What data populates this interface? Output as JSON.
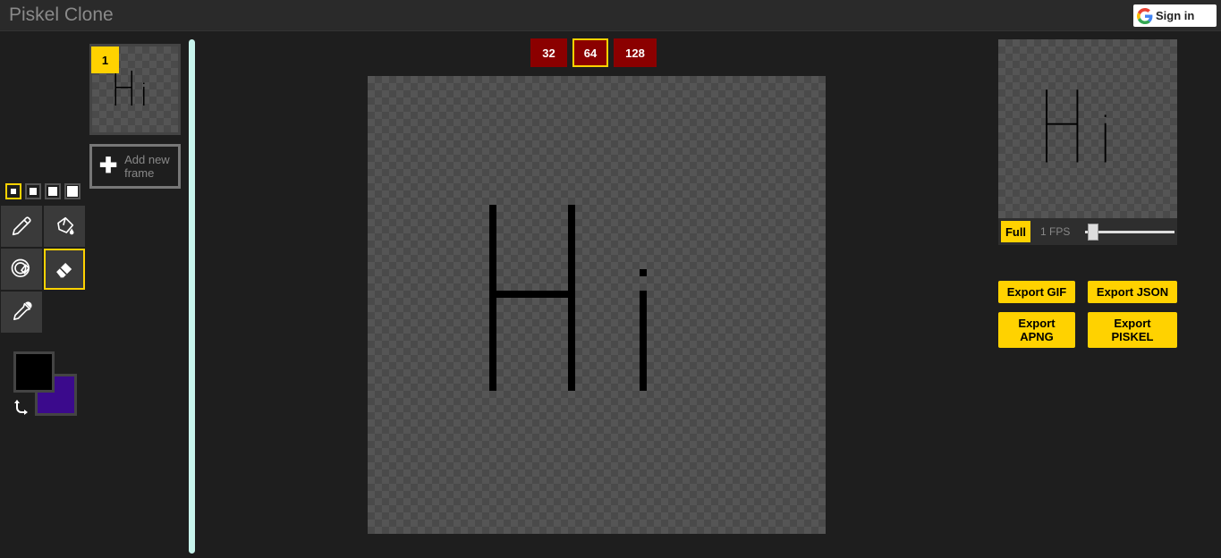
{
  "app": {
    "title": "Piskel Clone"
  },
  "auth": {
    "sign_in_label": "Sign in"
  },
  "frames": [
    {
      "number": "1"
    }
  ],
  "add_frame_label": "Add new frame",
  "resolutions": [
    {
      "label": "32",
      "active": false
    },
    {
      "label": "64",
      "active": true
    },
    {
      "label": "128",
      "active": false
    }
  ],
  "tools": [
    "pencil-icon",
    "paint-bucket-icon",
    "same-color-fill-icon",
    "eraser-icon",
    "eyedropper-icon"
  ],
  "active_tool": "eraser",
  "colors": {
    "primary": "#000000",
    "secondary": "#3b0a8c",
    "accent": "#ffd200",
    "resolution_button": "#8b0000"
  },
  "canvas": {
    "drawing_text": "Hi"
  },
  "preview": {
    "full_label": "Full",
    "fps_label": "1 FPS",
    "fps_value": 1
  },
  "export": {
    "gif": "Export GIF",
    "json": "Export JSON",
    "apng": "Export APNG",
    "piskel": "Export PISKEL"
  }
}
